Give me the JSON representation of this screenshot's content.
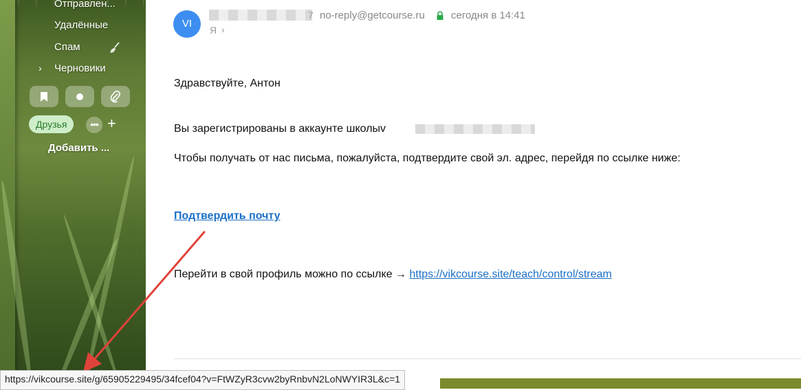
{
  "sidebar": {
    "folders": [
      "Отправлен...",
      "Удалённые",
      "Спам",
      "Черновики"
    ],
    "tag_label": "Друзья",
    "add_label": "Добавить ...",
    "more_label": "•••",
    "plus_label": "+"
  },
  "message": {
    "avatar_initials": "VI",
    "from_email": "no-reply@getcourse.ru",
    "date": "сегодня в 14:41",
    "recipient": "Я",
    "greeting": "Здравствуйте, Антон",
    "registered": "Вы зарегистрированы в  аккаунте школыv",
    "confirm_request": "Чтобы получать от нас письма, пожалуйста, подтвердите свой эл. адрес, перейдя по ссылке ниже:",
    "confirm_link": "Подтвердить почту",
    "profile_text": "Перейти в свой профиль можно по ссылке",
    "profile_arrow": "→",
    "profile_link": "https://vikcourse.site/teach/control/stream"
  },
  "status_bar": {
    "url": "https://vikcourse.site/g/65905229495/34fcef04?v=FtWZyR3cvw2byRnbvN2LoNWYIR3L&c=1"
  },
  "colors": {
    "link": "#1a6fc6",
    "avatar": "#3d8ef0",
    "tag_bg": "#cdeec9",
    "annotation_arrow": "#e0433a"
  }
}
